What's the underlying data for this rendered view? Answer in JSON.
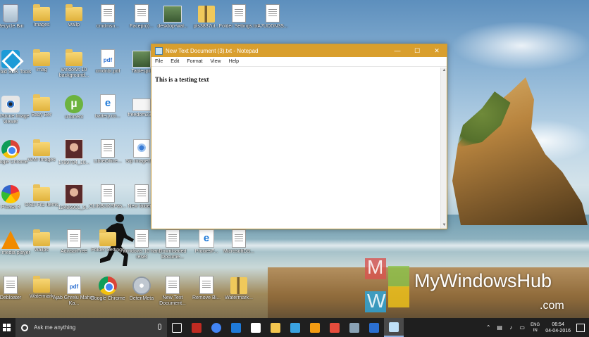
{
  "desktop": {
    "icons": [
      {
        "label": "Recycle Bin",
        "type": "recycle"
      },
      {
        "label": "Images",
        "type": "folder"
      },
      {
        "label": "wallp",
        "type": "folder"
      },
      {
        "label": "cmdmsn...",
        "type": "doc"
      },
      {
        "label": "Facepr(i)...",
        "type": "doc"
      },
      {
        "label": "desktop-wal...",
        "type": "photo"
      },
      {
        "label": "pfs3837ut...",
        "type": "zip"
      },
      {
        "label": "Folder Settings.txt",
        "type": "doc"
      },
      {
        "label": "A7UDDN3S...",
        "type": "doc"
      },
      {
        "label": "Android SDK Tools",
        "type": "sdk"
      },
      {
        "label": "Imag",
        "type": "folder"
      },
      {
        "label": "windows 10 background...",
        "type": "folder"
      },
      {
        "label": "cmdnbr.pdf",
        "type": "pdf"
      },
      {
        "label": "Tablesplit",
        "type": "photo"
      },
      {
        "label": "FastStone Image Viewer",
        "type": "eye"
      },
      {
        "label": "Baby Ber",
        "type": "folder"
      },
      {
        "label": "uTorrent",
        "type": "utorrent"
      },
      {
        "label": "battery.co...",
        "type": "edge"
      },
      {
        "label": "freedom23...",
        "type": "card"
      },
      {
        "label": "Google Chrome",
        "type": "chrome"
      },
      {
        "label": "WMI Images",
        "type": "folder"
      },
      {
        "label": "1789784_10...",
        "type": "face"
      },
      {
        "label": "LibreOffice...",
        "type": "doc"
      },
      {
        "label": "Sfp image29...",
        "type": "setup"
      },
      {
        "label": "Picasa 3",
        "type": "picasa"
      },
      {
        "label": "OSD Fitz Items",
        "type": "folder"
      },
      {
        "label": "12486901_9...",
        "type": "face"
      },
      {
        "label": "CLIKBUKSPas...",
        "type": "doc"
      },
      {
        "label": "New folder...",
        "type": "doc"
      },
      {
        "label": "VLC media player",
        "type": "vlc"
      },
      {
        "label": "wallps",
        "type": "folder"
      },
      {
        "label": "AdvisorFree",
        "type": "doc"
      },
      {
        "label": "Folder Settings",
        "type": "folder"
      },
      {
        "label": "Windows 10 hard reset",
        "type": "doc"
      },
      {
        "label": "Downloaded Docume...",
        "type": "doc"
      },
      {
        "label": "ProxiesF...",
        "type": "edge"
      },
      {
        "label": "MicrosoftDS...",
        "type": "doc"
      },
      {
        "label": "Debloater",
        "type": "doc"
      },
      {
        "label": "Watermark",
        "type": "folder"
      },
      {
        "label": "Ajab Ghrelu Mahne Ka...",
        "type": "pdf"
      },
      {
        "label": "Google Chrome",
        "type": "chrome"
      },
      {
        "label": "DetenMeta",
        "type": "disc"
      },
      {
        "label": "New Text Document...",
        "type": "doc"
      },
      {
        "label": "Remove Bl...",
        "type": "doc"
      },
      {
        "label": "Watermark...",
        "type": "zip"
      }
    ]
  },
  "notepad": {
    "title": "New Text Document (3).txt - Notepad",
    "menus": [
      "File",
      "Edit",
      "Format",
      "View",
      "Help"
    ],
    "content": "This is a testing text",
    "controls": {
      "minimize": "—",
      "maximize": "☐",
      "close": "✕"
    }
  },
  "watermark": {
    "text": "MyWindowsHub",
    "suffix": ".com",
    "letters": [
      "M",
      "W"
    ],
    "colors": [
      "#d9534f",
      "#8bc34a",
      "#29a8e0",
      "#f0c419"
    ]
  },
  "taskbar": {
    "search_placeholder": "Ask me anything",
    "apps": [
      {
        "name": "task-view",
        "color": "#ffffff"
      },
      {
        "name": "filezilla",
        "color": "#bf2b22"
      },
      {
        "name": "chrome",
        "color": "#4285f4"
      },
      {
        "name": "edge",
        "color": "#1f7ad8"
      },
      {
        "name": "store",
        "color": "#ffffff"
      },
      {
        "name": "file-explorer",
        "color": "#f3c64f"
      },
      {
        "name": "photos",
        "color": "#3aa2e0"
      },
      {
        "name": "picasa",
        "color": "#f39c12"
      },
      {
        "name": "faststone",
        "color": "#e74c3c"
      },
      {
        "name": "windows-app",
        "color": "#8aa2b5"
      },
      {
        "name": "word-app",
        "color": "#2b6fd1"
      },
      {
        "name": "notepad",
        "color": "#bfe0f7"
      }
    ],
    "tray": {
      "lang": "ENG",
      "region": "IN",
      "time": "06:54",
      "date": "04-04-2016"
    }
  }
}
